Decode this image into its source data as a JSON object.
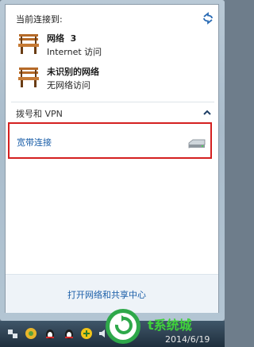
{
  "panel": {
    "header": "当前连接到:",
    "networks": [
      {
        "name": "网络  3",
        "status": "Internet 访问"
      },
      {
        "name": "未识别的网络",
        "status": "无网络访问"
      }
    ],
    "section_title": "拨号和 VPN",
    "vpn_connection": "宽带连接",
    "footer_link": "打开网络和共享中心"
  },
  "taskbar": {
    "watermark_text": "t系统城",
    "date_text": "2014/6/19"
  },
  "icons": {
    "refresh": "refresh-icon",
    "network": "bench-network-icon",
    "collapse": "chevron-up-icon",
    "modem": "modem-icon"
  },
  "colors": {
    "link": "#1a5ea8",
    "highlight_border": "#d42020",
    "watermark": "#3fd23a"
  }
}
